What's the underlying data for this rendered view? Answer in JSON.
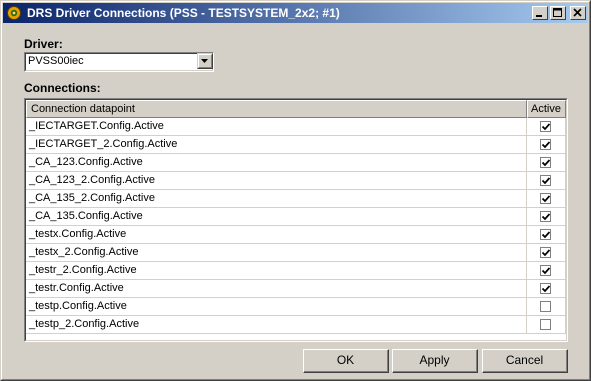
{
  "window": {
    "title": "DRS Driver Connections (PSS - TESTSYSTEM_2x2; #1)",
    "icon": "gear-app-icon",
    "controls": [
      "minimize-icon",
      "maximize-icon",
      "close-icon"
    ]
  },
  "driver": {
    "label": "Driver:",
    "selected": "PVSS00iec"
  },
  "connections": {
    "label": "Connections:",
    "columns": [
      "Connection datapoint",
      "Active"
    ],
    "rows": [
      {
        "name": "_IECTARGET.Config.Active",
        "active": true
      },
      {
        "name": "_IECTARGET_2.Config.Active",
        "active": true
      },
      {
        "name": "_CA_123.Config.Active",
        "active": true
      },
      {
        "name": "_CA_123_2.Config.Active",
        "active": true
      },
      {
        "name": "_CA_135_2.Config.Active",
        "active": true
      },
      {
        "name": "_CA_135.Config.Active",
        "active": true
      },
      {
        "name": "_testx.Config.Active",
        "active": true
      },
      {
        "name": "_testx_2.Config.Active",
        "active": true
      },
      {
        "name": "_testr_2.Config.Active",
        "active": true
      },
      {
        "name": "_testr.Config.Active",
        "active": true
      },
      {
        "name": "_testp.Config.Active",
        "active": false
      },
      {
        "name": "_testp_2.Config.Active",
        "active": false
      }
    ]
  },
  "buttons": {
    "ok": "OK",
    "apply": "Apply",
    "cancel": "Cancel"
  }
}
